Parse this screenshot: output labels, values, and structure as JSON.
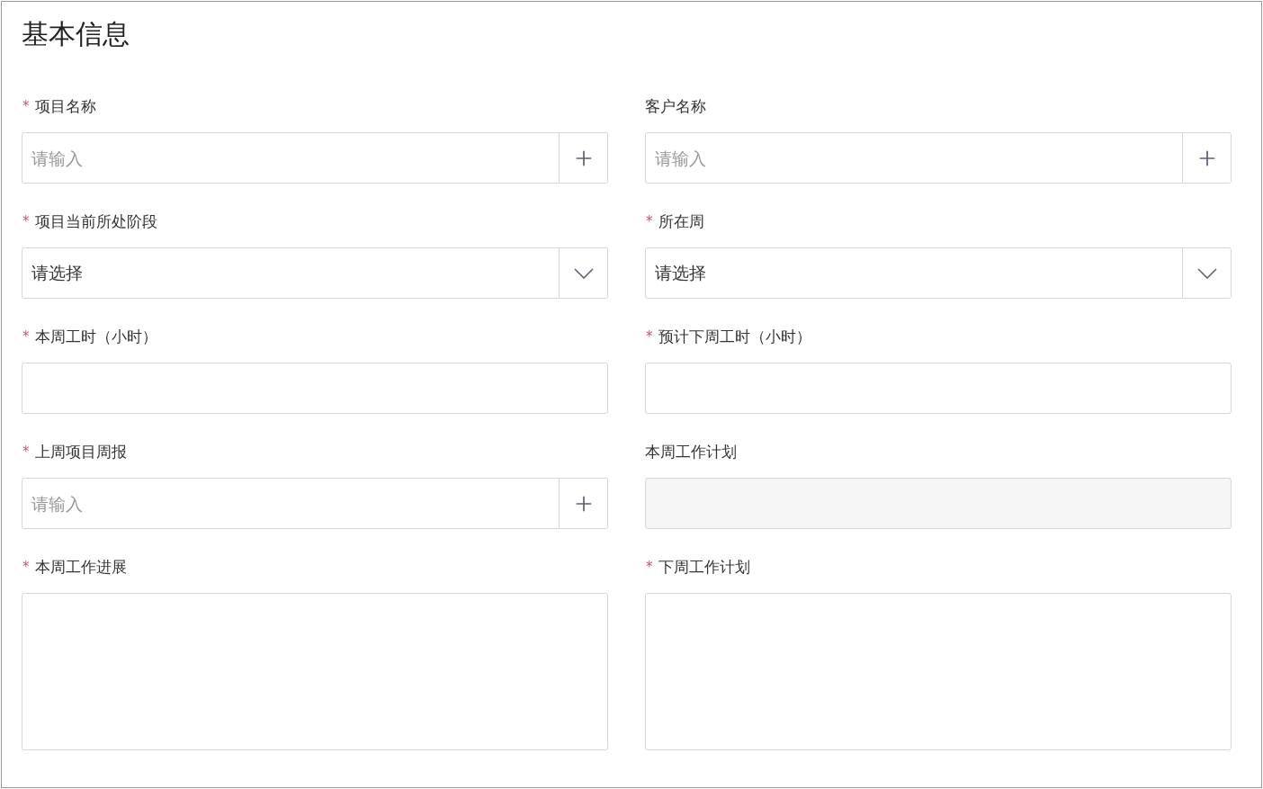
{
  "title": "基本信息",
  "fields": [
    {
      "kind": "input-add",
      "marker": "*",
      "label": "项目名称",
      "placeholder": "请输入"
    },
    {
      "kind": "input-add",
      "label": "客户名称",
      "placeholder": "请输入"
    },
    {
      "kind": "select",
      "marker": "*",
      "label": "项目当前所处阶段",
      "placeholder": "请选择"
    },
    {
      "kind": "select",
      "marker": "*",
      "label": "所在周",
      "placeholder": "请选择"
    },
    {
      "kind": "input",
      "marker": "*",
      "label": "本周工时（小时）"
    },
    {
      "kind": "input",
      "marker": "*",
      "label": "预计下周工时（小时）"
    },
    {
      "kind": "input-add",
      "marker": "*",
      "label": "上周项目周报",
      "placeholder": "请输入"
    },
    {
      "kind": "disabled",
      "label": "本周工作计划"
    },
    {
      "kind": "textarea",
      "marker": "*",
      "label": "本周工作进展"
    },
    {
      "kind": "textarea",
      "marker": "*",
      "label": "下周工作计划"
    }
  ]
}
